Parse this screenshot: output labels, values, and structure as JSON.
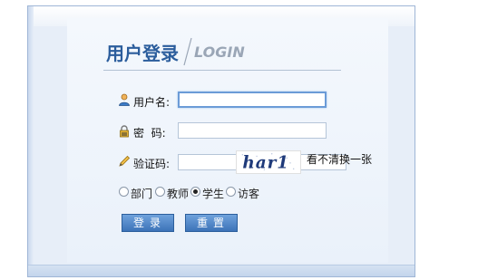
{
  "header": {
    "title_cn": "用户登录",
    "title_en": "LOGIN"
  },
  "form": {
    "username_label": "用户名:",
    "password_label": "密  码:",
    "captcha_label": "验证码:",
    "captcha_text": "har1",
    "refresh_label": "看不清换一张"
  },
  "roles": {
    "options": [
      "部门",
      "教师",
      "学生",
      "访客"
    ],
    "selected": "学生"
  },
  "buttons": {
    "login": "登录",
    "reset": "重置"
  },
  "colors": {
    "accent": "#2b5d9c",
    "button": "#3c73b8",
    "panel": "#e7eef8"
  },
  "icons": [
    "user-icon",
    "lock-icon",
    "pencil-icon"
  ]
}
